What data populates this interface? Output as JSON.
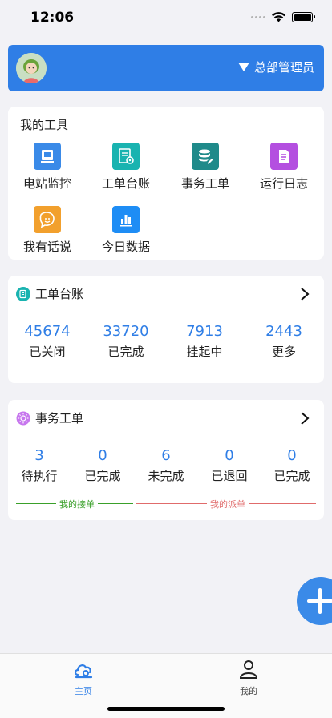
{
  "status_bar": {
    "time": "12:06"
  },
  "header": {
    "role": "总部管理员"
  },
  "tools": {
    "title": "我的工具",
    "items": [
      {
        "label": "电站监控",
        "icon": "monitor-icon",
        "color": "#3a8ae8"
      },
      {
        "label": "工单台账",
        "icon": "ledger-settings-icon",
        "color": "#19b3b0"
      },
      {
        "label": "事务工单",
        "icon": "database-edit-icon",
        "color": "#1f8a8a"
      },
      {
        "label": "运行日志",
        "icon": "log-document-icon",
        "color": "#b44fe0"
      },
      {
        "label": "我有话说",
        "icon": "speech-face-icon",
        "color": "#f2a02d"
      },
      {
        "label": "今日数据",
        "icon": "bar-chart-icon",
        "color": "#1e8df5"
      }
    ]
  },
  "ledger": {
    "title": "工单台账",
    "stats": [
      {
        "value": "45674",
        "label": "已关闭"
      },
      {
        "value": "33720",
        "label": "已完成"
      },
      {
        "value": "7913",
        "label": "挂起中"
      },
      {
        "value": "2443",
        "label": "更多"
      }
    ]
  },
  "affairs": {
    "title": "事务工单",
    "stats": [
      {
        "value": "3",
        "label": "待执行"
      },
      {
        "value": "0",
        "label": "已完成"
      },
      {
        "value": "6",
        "label": "未完成"
      },
      {
        "value": "0",
        "label": "已退回"
      },
      {
        "value": "0",
        "label": "已完成"
      }
    ],
    "legend_received": "我的接单",
    "legend_dispatched": "我的派单",
    "received_color": "#3aa02a",
    "dispatched_color": "#e06b6b"
  },
  "tabbar": {
    "home": "主页",
    "mine": "我的",
    "active_color": "#2f7ee6"
  }
}
